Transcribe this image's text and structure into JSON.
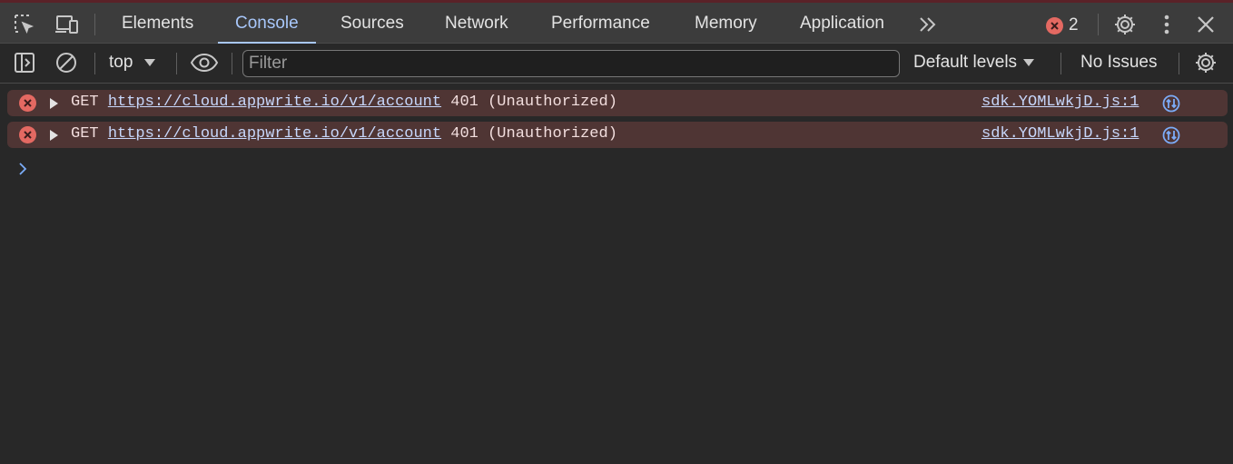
{
  "tabs": [
    {
      "label": "Elements",
      "active": false
    },
    {
      "label": "Console",
      "active": true
    },
    {
      "label": "Sources",
      "active": false
    },
    {
      "label": "Network",
      "active": false
    },
    {
      "label": "Performance",
      "active": false
    },
    {
      "label": "Memory",
      "active": false
    },
    {
      "label": "Application",
      "active": false
    }
  ],
  "more_tabs_icon": "chevron-double-right-icon",
  "error_count": "2",
  "toolbar": {
    "context": "top",
    "filter_placeholder": "Filter",
    "filter_value": "",
    "levels": "Default levels",
    "issues": "No Issues"
  },
  "messages": [
    {
      "method": "GET",
      "url": "https://cloud.appwrite.io/v1/account",
      "status": "401 (Unauthorized)",
      "source": "sdk.YOMLwkjD.js:1"
    },
    {
      "method": "GET",
      "url": "https://cloud.appwrite.io/v1/account",
      "status": "401 (Unauthorized)",
      "source": "sdk.YOMLwkjD.js:1"
    }
  ],
  "colors": {
    "accent": "#a8c7fa",
    "error": "#e46962",
    "error_row_bg": "#4f3534",
    "panel_bg": "#282828"
  }
}
